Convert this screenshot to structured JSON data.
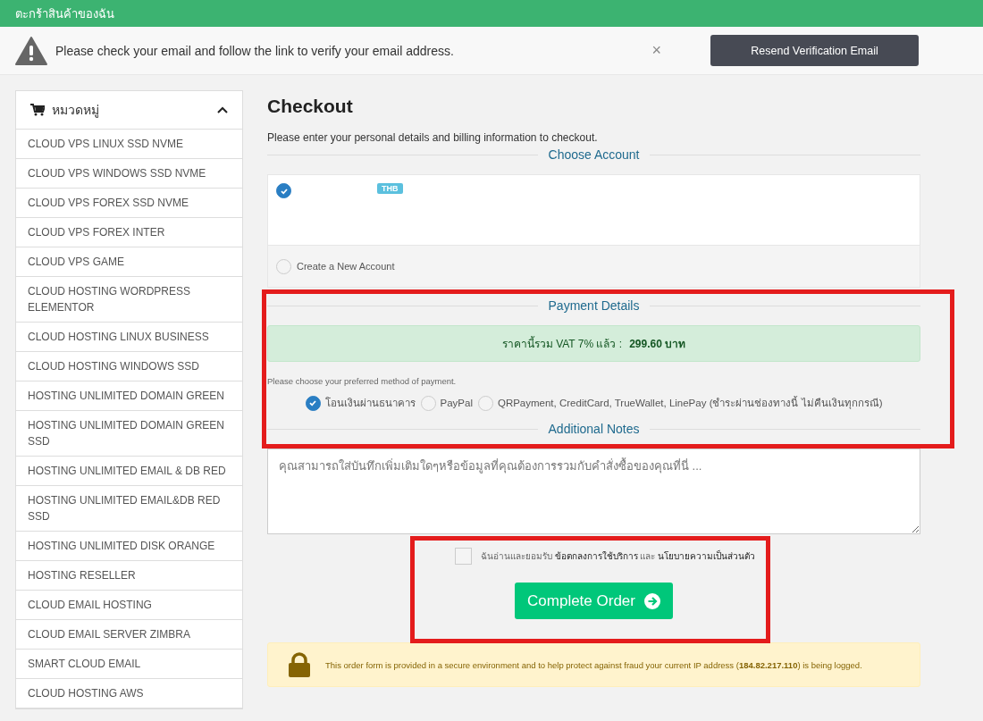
{
  "top_bar": {
    "title": "ตะกร้าสินค้าของฉัน"
  },
  "alert": {
    "message": "Please check your email and follow the link to verify your email address.",
    "close": "×",
    "button": "Resend Verification Email"
  },
  "sidebar": {
    "title": "หมวดหมู่",
    "expanded": true,
    "items": [
      {
        "label": "CLOUD VPS LINUX SSD NVME"
      },
      {
        "label": "CLOUD VPS WINDOWS SSD NVME"
      },
      {
        "label": "CLOUD VPS FOREX SSD NVME"
      },
      {
        "label": "CLOUD VPS FOREX INTER"
      },
      {
        "label": "CLOUD VPS GAME"
      },
      {
        "label": "CLOUD HOSTING WORDPRESS ELEMENTOR"
      },
      {
        "label": "CLOUD HOSTING LINUX BUSINESS"
      },
      {
        "label": "CLOUD HOSTING WINDOWS SSD"
      },
      {
        "label": "HOSTING UNLIMITED DOMAIN GREEN"
      },
      {
        "label": "HOSTING UNLIMITED DOMAIN GREEN SSD"
      },
      {
        "label": "HOSTING UNLIMITED EMAIL & DB RED"
      },
      {
        "label": "HOSTING UNLIMITED EMAIL&DB RED SSD"
      },
      {
        "label": "HOSTING UNLIMITED DISK ORANGE"
      },
      {
        "label": "HOSTING RESELLER"
      },
      {
        "label": "CLOUD EMAIL HOSTING"
      },
      {
        "label": "CLOUD EMAIL SERVER ZIMBRA"
      },
      {
        "label": "SMART CLOUD EMAIL"
      },
      {
        "label": "CLOUD HOSTING AWS"
      }
    ]
  },
  "checkout": {
    "title": "Checkout",
    "intro": "Please enter your personal details and billing information to checkout.",
    "choose_account": {
      "heading": "Choose Account",
      "accounts": [
        {
          "kind": "existing",
          "badge": "THB",
          "selected": true
        },
        {
          "kind": "new",
          "label": "Create a New Account",
          "selected": false
        }
      ]
    },
    "payment": {
      "heading": "Payment Details",
      "price_label": "ราคานี้รวม VAT 7% แล้ว :",
      "price_value": "299.60 บาท",
      "hint": "Please choose your preferred method of payment.",
      "methods": [
        {
          "label": "โอนเงินผ่านธนาคาร",
          "selected": true
        },
        {
          "label": "PayPal",
          "selected": false
        },
        {
          "label": "QRPayment, CreditCard, TrueWallet, LinePay (ชำระผ่านช่องทางนี้ ไม่คืนเงินทุกกรณี)",
          "selected": false
        }
      ]
    },
    "notes": {
      "heading": "Additional Notes",
      "placeholder": "คุณสามารถใส่บันทึกเพิ่มเติมใดๆหรือข้อมูลที่คุณต้องการรวมกับคำสั่งซื้อของคุณที่นี่ ..."
    },
    "terms": {
      "checked": false,
      "text": "ฉันอ่านและยอมรับ",
      "link1": "ข้อตกลงการใช้บริการ",
      "and": "และ",
      "link2": "นโยบายความเป็นส่วนตัว"
    },
    "submit": "Complete Order",
    "secure_note": "This order form is provided in a secure environment and to help protect against fraud your current IP address (**184.82.217.110**) is being logged."
  }
}
